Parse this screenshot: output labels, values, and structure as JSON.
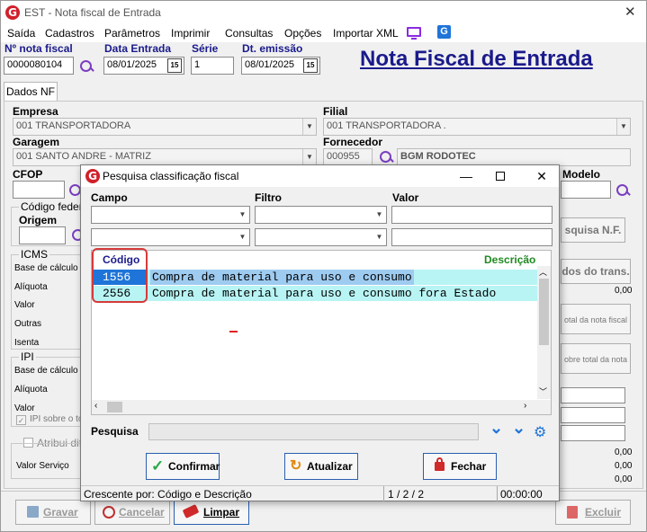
{
  "window": {
    "title": "EST - Nota fiscal de Entrada"
  },
  "menu": [
    "Saída",
    "Cadastros",
    "Parâmetros",
    "Imprimir",
    "Consultas",
    "Opções",
    "Importar XML"
  ],
  "header": {
    "nota_label": "Nº nota fiscal",
    "nota_value": "0000080104",
    "data_entrada_label": "Data Entrada",
    "data_entrada_value": "08/01/2025",
    "serie_label": "Série",
    "serie_value": "1",
    "dt_emissao_label": "Dt. emissão",
    "dt_emissao_value": "08/01/2025",
    "calendar_glyph": "15",
    "page_title": "Nota Fiscal de Entrada"
  },
  "tab": {
    "label": "Dados NF"
  },
  "form": {
    "empresa_label": "Empresa",
    "empresa_value": "001 TRANSPORTADORA",
    "filial_label": "Filial",
    "filial_value": "001 TRANSPORTADORA .",
    "garagem_label": "Garagem",
    "garagem_value": "001 SANTO ANDRE - MATRIZ",
    "fornecedor_label": "Fornecedor",
    "fornecedor_code": "000955",
    "fornecedor_name": "BGM RODOTEC",
    "cfop_label": "CFOP",
    "modelo_label": "Modelo",
    "codigo_federal_label": "Código federa",
    "origem_label": "Origem",
    "icms_label": "ICMS",
    "icms_fields": [
      "Base de cálculo",
      "Alíquota",
      "Valor",
      "Outras",
      "Isenta"
    ],
    "ipi_label": "IPI",
    "ipi_fields": [
      "Base de cálculo",
      "Alíquota",
      "Valor"
    ],
    "ipi_sobre_label": "IPI sobre o to",
    "atribui_label": "Atribui dif.",
    "valor_servico_label": "Valor Serviço",
    "pesquisa_nf_btn": "squisa N.F.",
    "dados_trans_btn": "dos do trans.",
    "total_nota_label": "otal da nota fiscal",
    "sobre_total_label": "obre total da nota",
    "right_values": [
      "0,00",
      "0,00",
      "0,00",
      "0,00"
    ]
  },
  "bottom_buttons": {
    "gravar": "Gravar",
    "cancelar": "Cancelar",
    "limpar": "Limpar",
    "excluir": "Excluir"
  },
  "dialog": {
    "title": "Pesquisa classificação fiscal",
    "campo_label": "Campo",
    "filtro_label": "Filtro",
    "valor_label": "Valor",
    "grid_headers": {
      "codigo": "Código",
      "descricao": "Descrição"
    },
    "rows": [
      {
        "codigo": "1556",
        "descricao": "Compra de material para uso e consumo"
      },
      {
        "codigo": "2556",
        "descricao": "Compra de material para uso e consumo fora Estado"
      }
    ],
    "pesquisa_label": "Pesquisa",
    "buttons": {
      "confirmar": "Confirmar",
      "atualizar": "Atualizar",
      "fechar": "Fechar"
    },
    "status": {
      "order": "Crescente por: Código e Descrição",
      "pages": "1 / 2 / 2",
      "time": "00:00:00"
    }
  },
  "colors": {
    "selected_row": "#1e74d8",
    "alt_row": "#b8f4f4",
    "highlight_box": "#d63a3a",
    "title_navy": "#1a1a8c",
    "descricao_green": "#208a20"
  }
}
